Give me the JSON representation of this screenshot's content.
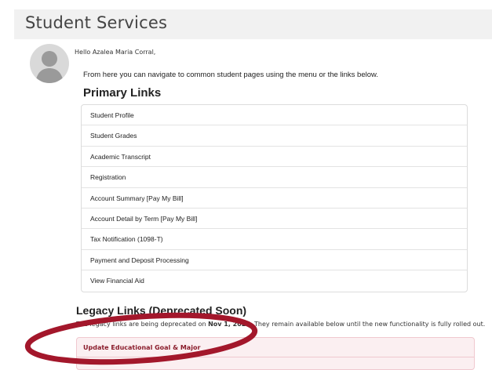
{
  "header": {
    "title": "Student Services"
  },
  "greeting": "Hello Azalea Maria Corral,",
  "intro": "From here you can navigate to common student pages using the menu or the links below.",
  "primary": {
    "title": "Primary Links",
    "items": [
      {
        "label": "Student Profile"
      },
      {
        "label": "Student Grades"
      },
      {
        "label": "Academic Transcript"
      },
      {
        "label": "Registration"
      },
      {
        "label": "Account Summary [Pay My Bill]"
      },
      {
        "label": "Account Detail by Term [Pay My Bill]"
      },
      {
        "label": "Tax Notification (1098-T)"
      },
      {
        "label": "Payment and Deposit Processing"
      },
      {
        "label": "View Financial Aid"
      }
    ]
  },
  "legacy": {
    "title": "Legacy Links (Deprecated Soon)",
    "note_prefix": "The legacy links are being deprecated on",
    "note_date": "Nov 1, 2025",
    "note_suffix": ". They remain available below until the new functionality is fully rolled out.",
    "items": [
      {
        "label": "Update Educational Goal & Major"
      }
    ]
  },
  "colors": {
    "annotation": "#a3172b",
    "legacy_link": "#8a1c2b",
    "legacy_bg": "#fbeff1"
  }
}
